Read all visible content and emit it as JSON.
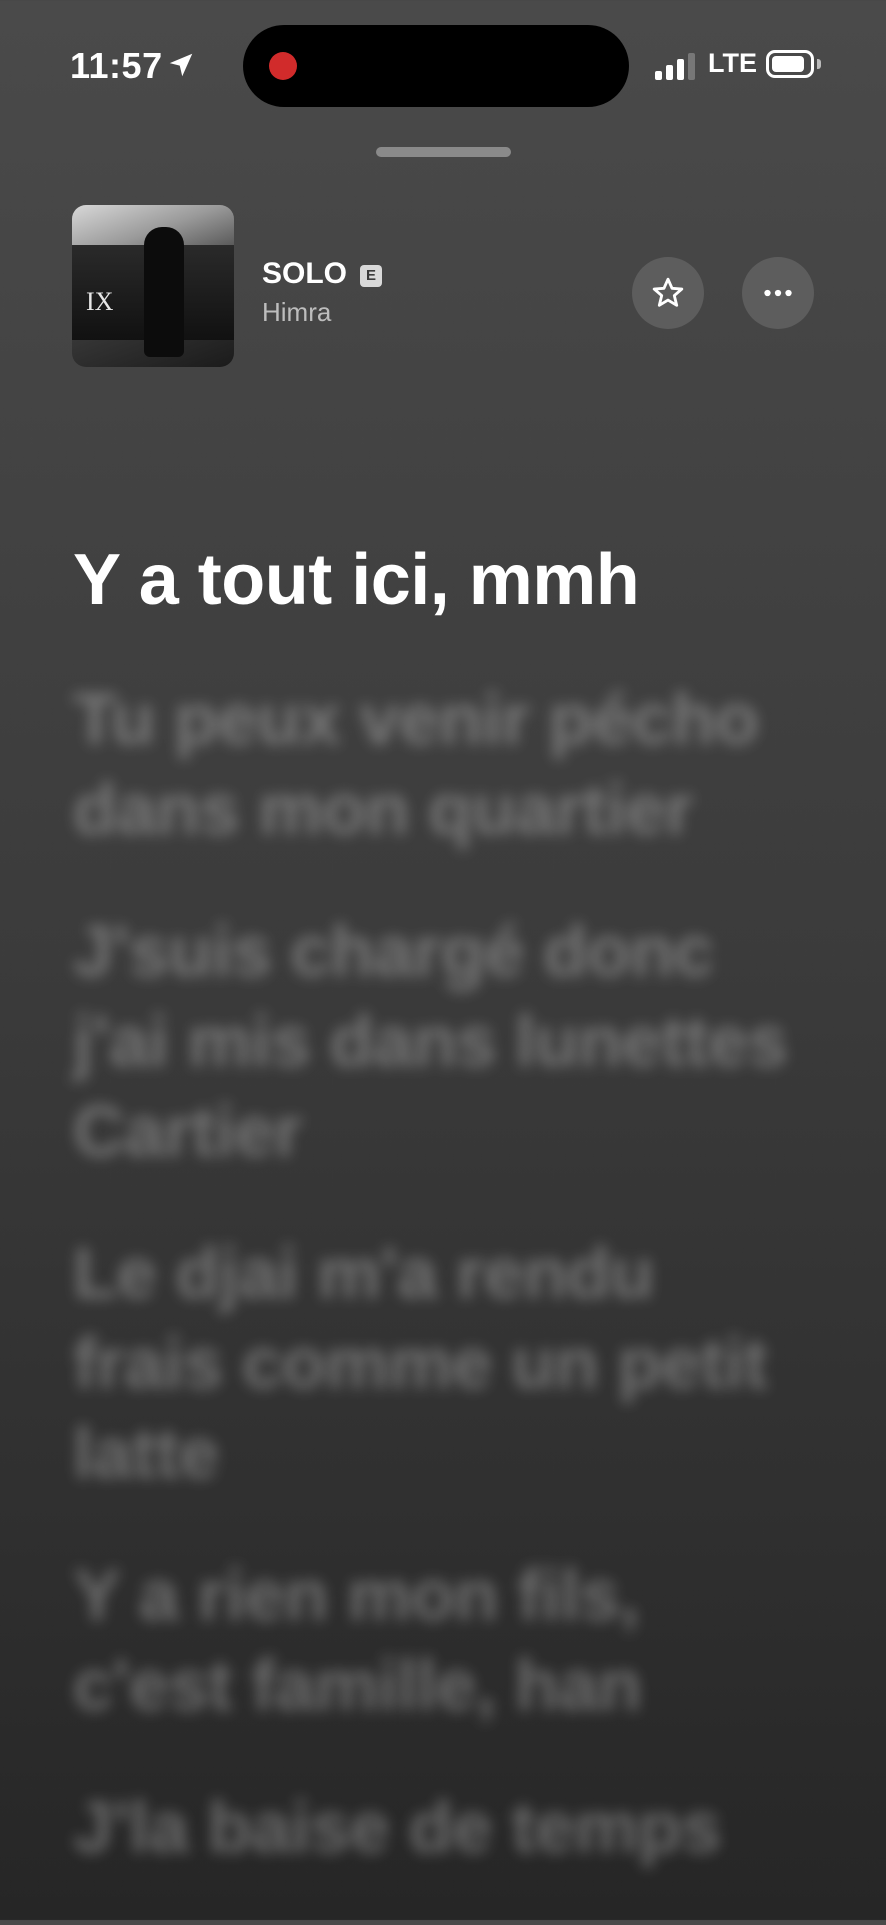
{
  "status_bar": {
    "time": "11:57",
    "network": "LTE",
    "recording": true,
    "signal_bars": 3,
    "colors": {
      "record_dot": "#d12b2b"
    }
  },
  "now_playing": {
    "title": "SOLO",
    "explicit_badge": "E",
    "artist": "Himra",
    "favorite_icon": "star-icon",
    "more_icon": "ellipsis-icon"
  },
  "lyrics": {
    "current_line": "Y a tout ici, mmh",
    "upcoming_lines": [
      "Tu peux venir pécho dans mon quartier",
      "J'suis chargé donc j'ai mis dans lunettes Cartier",
      "Le djai m'a rendu frais comme un petit latte",
      "Y a rien mon fils, c'est famille, han",
      "J'la baise de temps"
    ]
  }
}
